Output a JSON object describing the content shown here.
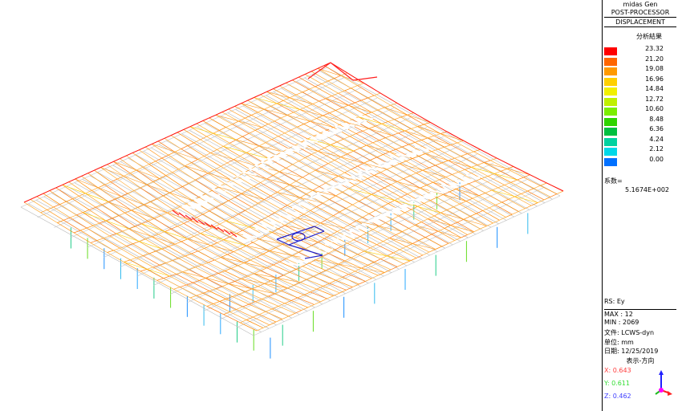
{
  "header": {
    "app": "midas Gen",
    "mode": "POST-PROCESSOR",
    "result_type": "DISPLACEMENT"
  },
  "legend": {
    "title": "分析結果",
    "values": [
      "23.32",
      "21.20",
      "19.08",
      "16.96",
      "14.84",
      "12.72",
      "10.60",
      "8.48",
      "6.36",
      "4.24",
      "2.12",
      "0.00"
    ],
    "colors": [
      "#ff0000",
      "#ff6600",
      "#ff9a00",
      "#ffd000",
      "#f2f000",
      "#c0f000",
      "#7cee00",
      "#2fd400",
      "#00c040",
      "#00d2a0",
      "#00d8e8",
      "#0070ff"
    ],
    "factor_label": "系数=",
    "factor_value": "5.1674E+002"
  },
  "info": {
    "rs": "RS: Ey",
    "max": "MAX : 12",
    "min": "MIN : 2069",
    "file": "文件: LCWS-dyn",
    "unit": "单位: mm",
    "date": "日期: 12/25/2019",
    "view_dir": "表示-方向"
  },
  "direction": {
    "x": "X: 0.643",
    "y": "Y: 0.611",
    "z": "Z: 0.462",
    "x_color": "#ff4040",
    "y_color": "#33dd33",
    "z_color": "#4040ff"
  }
}
